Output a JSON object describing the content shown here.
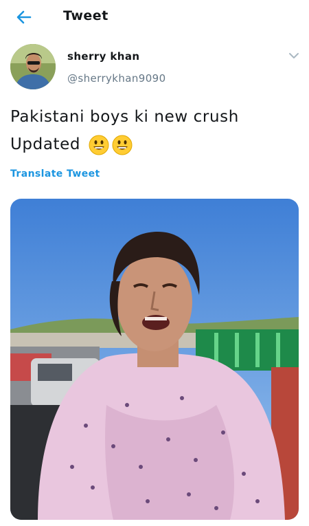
{
  "header": {
    "title": "Tweet",
    "back_icon": "arrow-left-icon"
  },
  "author": {
    "name": "sherry khan",
    "handle": "@sherrykhan9090"
  },
  "tweet": {
    "line1": "Pakistani boys ki new crush",
    "line2": "Updated",
    "emojis": [
      "grinning-face-icon",
      "grinning-face-icon"
    ]
  },
  "translate_label": "Translate Tweet",
  "colors": {
    "accent": "#1b95e0",
    "secondary_text": "#657786"
  }
}
